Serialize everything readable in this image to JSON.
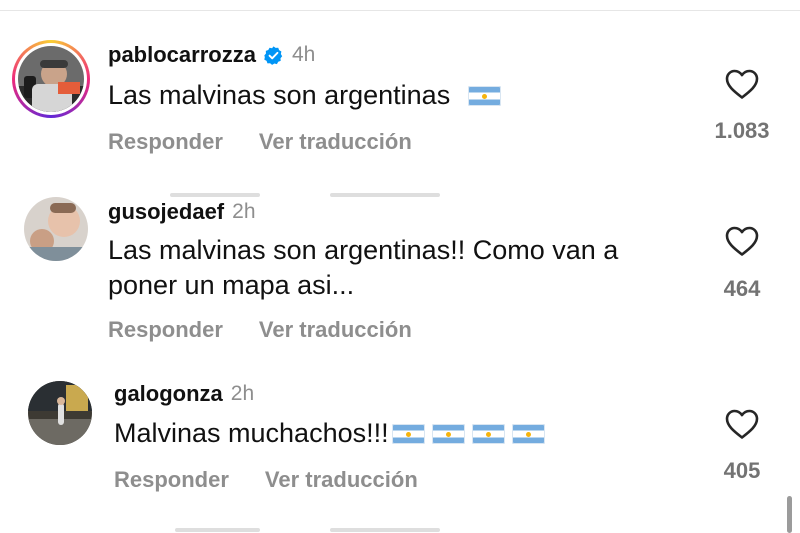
{
  "comments": [
    {
      "username": "pablocarrozza",
      "time": "4h",
      "text": "Las malvinas son argentinas",
      "text_line2": "",
      "flags": 1,
      "reply_label": "Responder",
      "translate_label": "Ver traducción",
      "likes": "1.083",
      "verified": true,
      "has_story_ring": true
    },
    {
      "username": "gusojedaef",
      "time": "2h",
      "text": "Las malvinas son argentinas!! Como van a",
      "text_line2": "poner un mapa asi...",
      "flags": 0,
      "reply_label": "Responder",
      "translate_label": "Ver traducción",
      "likes": "464",
      "verified": false,
      "has_story_ring": false
    },
    {
      "username": "galogonza",
      "time": "2h",
      "text": "Malvinas muchachos!!!",
      "text_line2": "",
      "flags": 4,
      "reply_label": "Responder",
      "translate_label": "Ver traducción",
      "likes": "405",
      "verified": false,
      "has_story_ring": false
    }
  ],
  "icons": {
    "like": "heart-outline-icon",
    "verified": "verified-badge-icon",
    "flag": "argentina-flag-emoji"
  },
  "colors": {
    "verified_blue": "#0095f6",
    "muted_text": "#8e8e8e",
    "flag_blue": "#74acdf",
    "flag_sun": "#f6b40e"
  }
}
